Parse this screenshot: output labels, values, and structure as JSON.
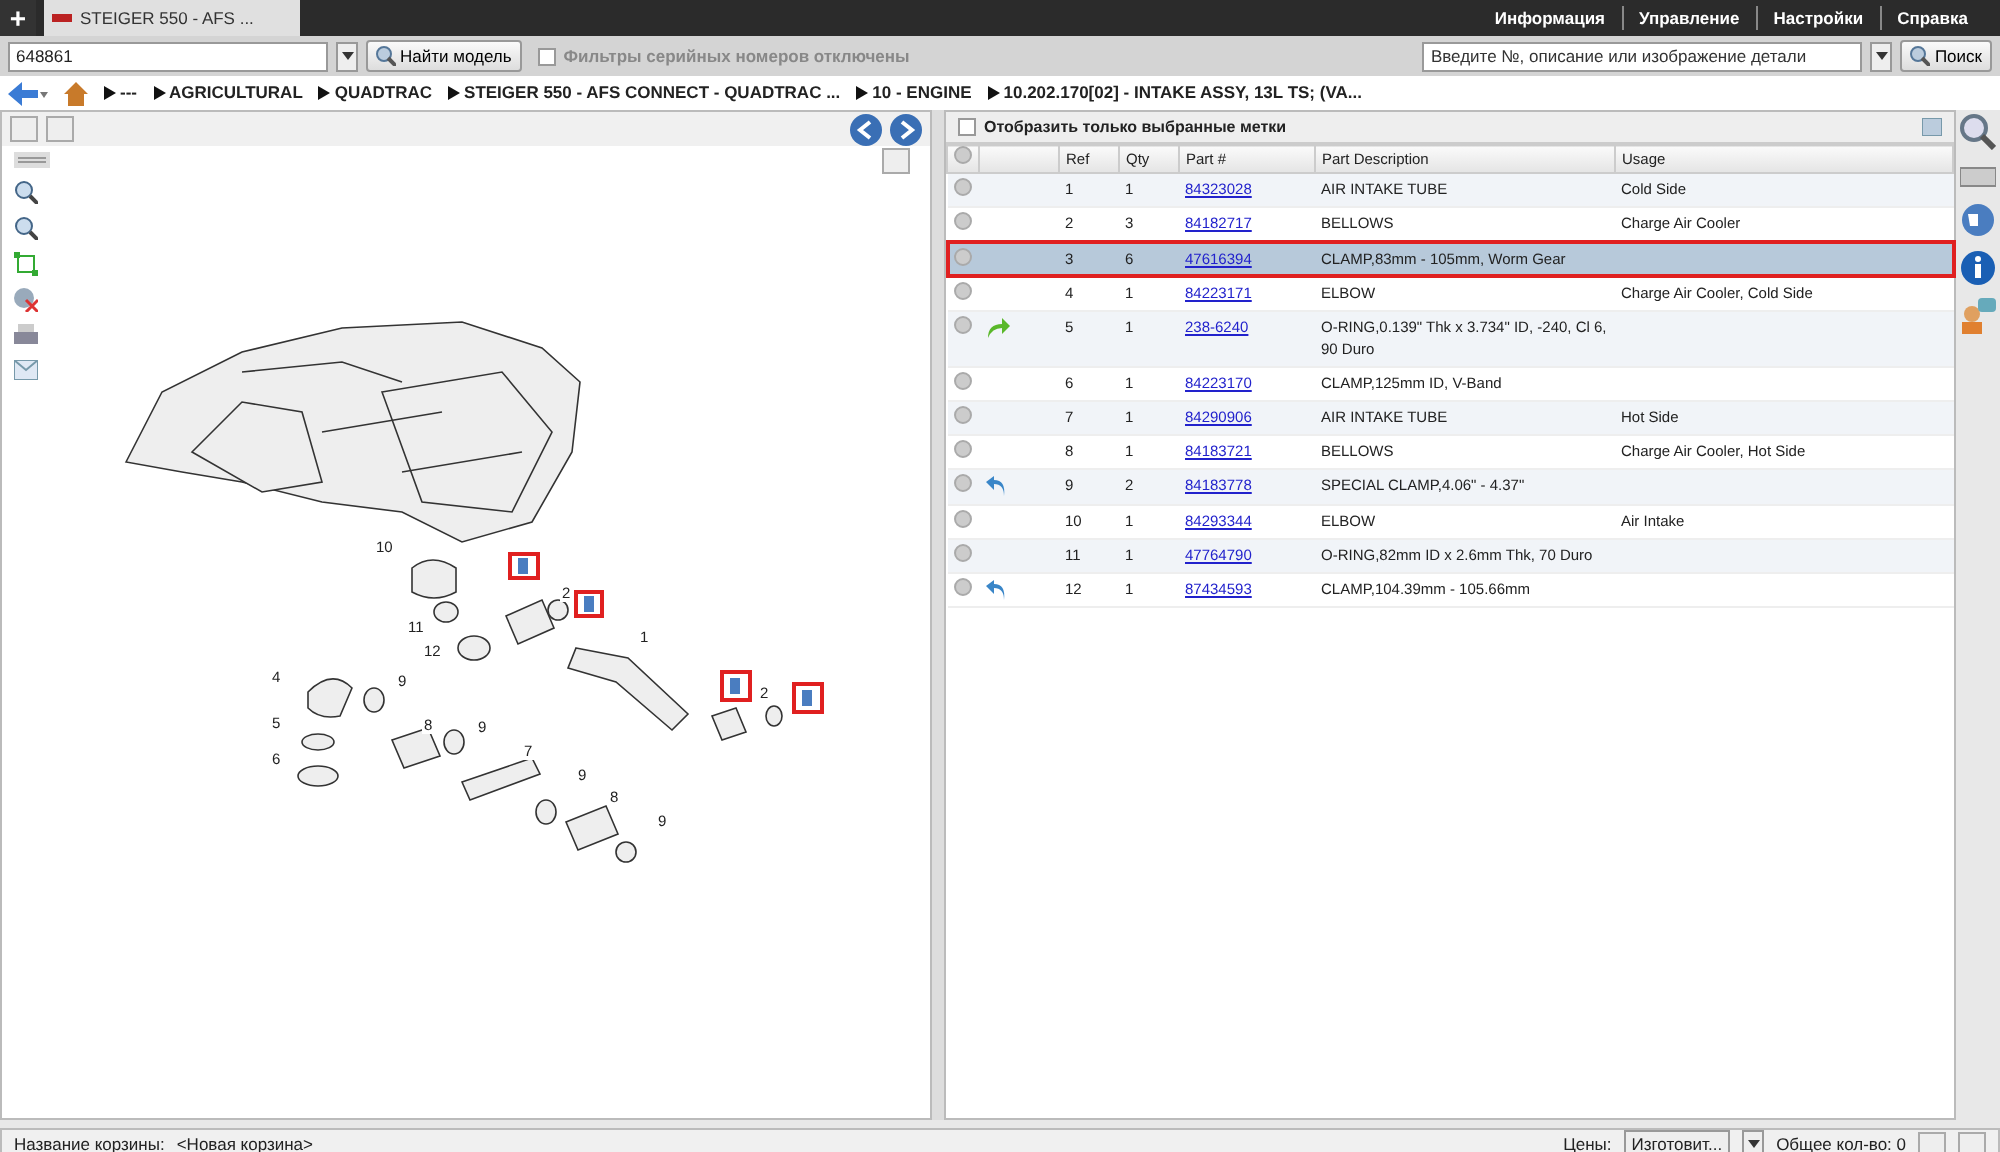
{
  "new_tab": "+",
  "tab": {
    "title": "STEIGER 550 - AFS ..."
  },
  "top_menu": [
    "Информация",
    "Управление",
    "Настройки",
    "Справка"
  ],
  "model_search": {
    "value": "648861",
    "button": "Найти модель"
  },
  "serial_filter": {
    "label": "Фильтры серийных номеров отключены",
    "checked": false
  },
  "part_search": {
    "placeholder": "Введите №, описание или изображение детали",
    "button": "Поиск"
  },
  "breadcrumb": [
    "---",
    "AGRICULTURAL",
    "QUADTRAC",
    "STEIGER 550 - AFS CONNECT - QUADTRAC ...",
    "10 - ENGINE",
    "10.202.170[02] - INTAKE ASSY, 13L TS; (VA..."
  ],
  "diagram": {
    "callouts": [
      {
        "label": "10"
      },
      {
        "label": "11"
      },
      {
        "label": "12"
      },
      {
        "label": "2"
      },
      {
        "label": "1"
      },
      {
        "label": "4"
      },
      {
        "label": "5"
      },
      {
        "label": "6"
      },
      {
        "label": "9"
      },
      {
        "label": "8"
      },
      {
        "label": "9"
      },
      {
        "label": "7"
      },
      {
        "label": "9"
      },
      {
        "label": "8"
      },
      {
        "label": "9"
      },
      {
        "label": "2"
      }
    ]
  },
  "show_selected_only": {
    "label": "Отобразить только выбранные метки",
    "checked": false
  },
  "table": {
    "columns": [
      "Ref",
      "Qty",
      "Part #",
      "Part Description",
      "Usage"
    ],
    "rows": [
      {
        "ref": "1",
        "qty": "1",
        "part": "84323028",
        "description": "AIR INTAKE TUBE",
        "usage": "Cold Side",
        "selected": false,
        "kind": "plain"
      },
      {
        "ref": "2",
        "qty": "3",
        "part": "84182717",
        "description": "BELLOWS",
        "usage": "Charge Air Cooler",
        "selected": false,
        "kind": "plain"
      },
      {
        "ref": "3",
        "qty": "6",
        "part": "47616394",
        "description": "CLAMP,83mm - 105mm, Worm Gear",
        "selected": true,
        "kind": "plain"
      },
      {
        "ref": "4",
        "qty": "1",
        "part": "84223171",
        "description": "ELBOW",
        "usage": "Charge Air Cooler, Cold Side",
        "selected": false,
        "kind": "plain"
      },
      {
        "ref": "5",
        "qty": "1",
        "part": "238-6240",
        "description": "O-RING,0.139\" Thk x 3.734\" ID, -240, Cl 6, 90 Duro",
        "selected": false,
        "kind": "forward"
      },
      {
        "ref": "6",
        "qty": "1",
        "part": "84223170",
        "description": "CLAMP,125mm ID, V-Band",
        "selected": false,
        "kind": "plain"
      },
      {
        "ref": "7",
        "qty": "1",
        "part": "84290906",
        "description": "AIR INTAKE TUBE",
        "usage": "Hot Side",
        "selected": false,
        "kind": "plain"
      },
      {
        "ref": "8",
        "qty": "1",
        "part": "84183721",
        "description": "BELLOWS",
        "usage": "Charge Air Cooler, Hot Side",
        "selected": false,
        "kind": "plain"
      },
      {
        "ref": "9",
        "qty": "2",
        "part": "84183778",
        "description": "SPECIAL CLAMP,4.06\" - 4.37\"",
        "selected": false,
        "kind": "back"
      },
      {
        "ref": "10",
        "qty": "1",
        "part": "84293344",
        "description": "ELBOW",
        "usage": "Air Intake",
        "selected": false,
        "kind": "plain"
      },
      {
        "ref": "11",
        "qty": "1",
        "part": "47764790",
        "description": "O-RING,82mm ID x 2.6mm Thk, 70 Duro",
        "selected": false,
        "kind": "plain"
      },
      {
        "ref": "12",
        "qty": "1",
        "part": "87434593",
        "description": "CLAMP,104.39mm - 105.66mm",
        "selected": false,
        "kind": "back"
      }
    ]
  },
  "status_bar": {
    "basket_label": "Название корзины:",
    "basket_name": "<Новая корзина>",
    "prices_label": "Цены:",
    "prices_value": "Изготовит...",
    "total": "Общее кол-во: 0"
  }
}
